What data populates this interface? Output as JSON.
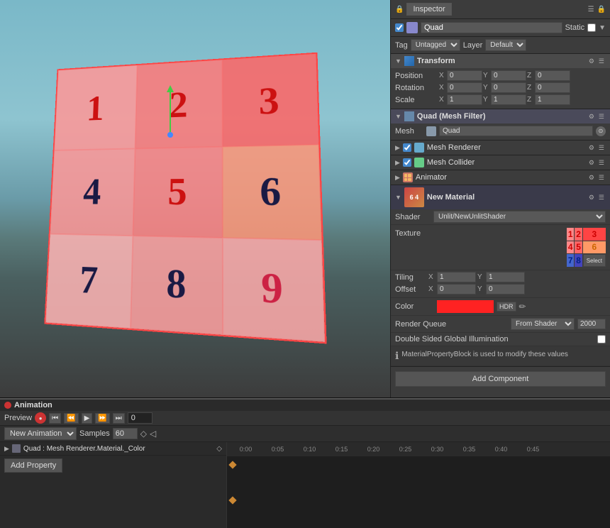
{
  "inspector": {
    "title": "Inspector",
    "game_object": {
      "name": "Quad",
      "static_label": "Static",
      "tag": "Untagged",
      "layer": "Default"
    },
    "transform": {
      "title": "Transform",
      "position": {
        "label": "Position",
        "x": "0",
        "y": "0",
        "z": "0"
      },
      "rotation": {
        "label": "Rotation",
        "x": "0",
        "y": "0",
        "z": "0"
      },
      "scale": {
        "label": "Scale",
        "x": "1",
        "y": "1",
        "z": "1"
      }
    },
    "quad_mesh_filter": {
      "title": "Quad (Mesh Filter)",
      "mesh_label": "Mesh",
      "mesh_value": "Quad"
    },
    "mesh_renderer": {
      "title": "Mesh Renderer"
    },
    "mesh_collider": {
      "title": "Mesh Collider"
    },
    "animator": {
      "title": "Animator"
    },
    "material": {
      "title": "New Material",
      "shader_label": "Shader",
      "shader_value": "Unlit/NewUnlitShader",
      "texture_label": "Texture",
      "tiling_label": "Tiling",
      "tiling_x": "1",
      "tiling_y": "1",
      "offset_label": "Offset",
      "offset_x": "0",
      "offset_y": "0",
      "color_label": "Color",
      "hdr_label": "HDR",
      "render_queue_label": "Render Queue",
      "render_queue_option": "From Shader",
      "render_queue_value": "2000",
      "double_sided_label": "Double Sided Global Illumination",
      "info_text": "MaterialPropertyBlock is used to modify these values"
    },
    "add_component_label": "Add Component"
  },
  "animation": {
    "title": "Animation",
    "preview_label": "Preview",
    "counter": "0",
    "new_animation_label": "New Animation",
    "samples_label": "Samples",
    "samples_value": "60",
    "track": {
      "name": "Quad : Mesh Renderer.Material._Color"
    },
    "add_property_label": "Add Property",
    "timeline_ticks": [
      "0:00",
      "0:05",
      "0:10",
      "0:15",
      "0:20",
      "0:25",
      "0:30",
      "0:35",
      "0:40",
      "0:45"
    ]
  },
  "scene": {
    "numbers": [
      "1",
      "2",
      "3",
      "4",
      "5",
      "6",
      "7",
      "8",
      "9"
    ]
  }
}
